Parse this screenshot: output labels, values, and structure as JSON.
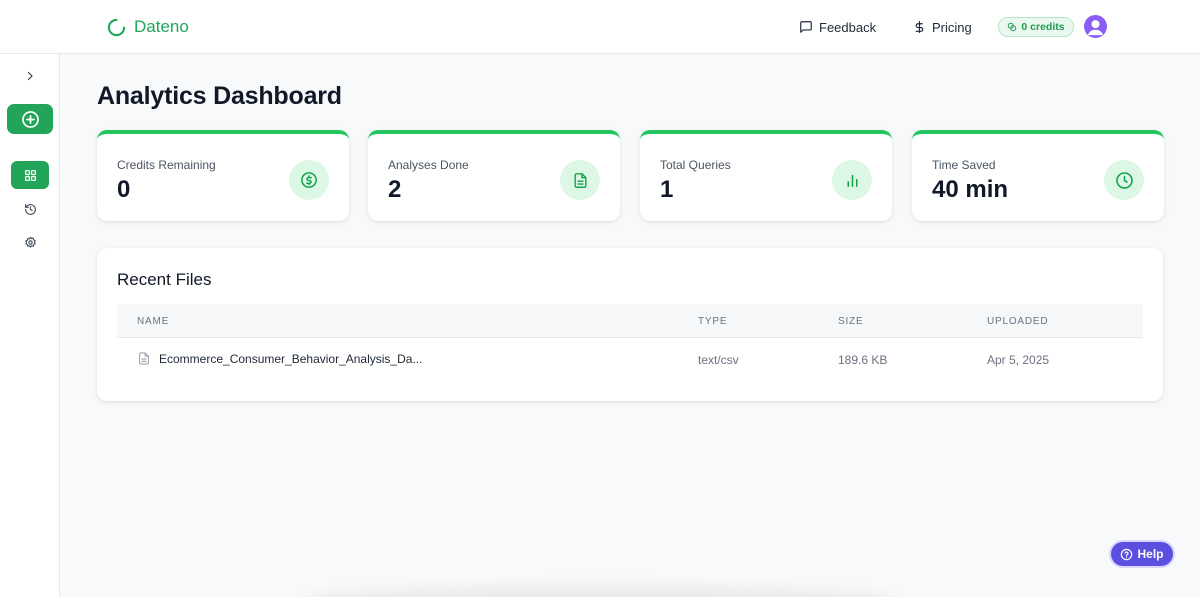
{
  "header": {
    "brand": "Dateno",
    "feedback_label": "Feedback",
    "pricing_label": "Pricing",
    "credits_label": "0 credits"
  },
  "sidebar": {
    "toggle_icon": "chevron-right-icon",
    "items": [
      {
        "name": "dashboard",
        "icon": "grid-icon",
        "active": true
      },
      {
        "name": "history",
        "icon": "history-icon",
        "active": false
      },
      {
        "name": "settings",
        "icon": "gear-icon",
        "active": false
      }
    ]
  },
  "main": {
    "title": "Analytics Dashboard",
    "stats": [
      {
        "label": "Credits Remaining",
        "value": "0",
        "icon": "dollar-circle-icon"
      },
      {
        "label": "Analyses Done",
        "value": "2",
        "icon": "document-icon"
      },
      {
        "label": "Total Queries",
        "value": "1",
        "icon": "bar-chart-icon"
      },
      {
        "label": "Time Saved",
        "value": "40 min",
        "icon": "clock-icon"
      }
    ],
    "recent_files": {
      "title": "Recent Files",
      "columns": [
        "Name",
        "Type",
        "Size",
        "Uploaded"
      ],
      "rows": [
        {
          "name": "Ecommerce_Consumer_Behavior_Analysis_Da...",
          "type": "text/csv",
          "size": "189.6 KB",
          "uploaded": "Apr 5, 2025"
        }
      ]
    }
  },
  "help": {
    "label": "Help"
  },
  "colors": {
    "accent": "#22a559",
    "accent_light": "#dcf7e6",
    "help": "#5b4fe0",
    "avatar": "#8b5cf6"
  }
}
